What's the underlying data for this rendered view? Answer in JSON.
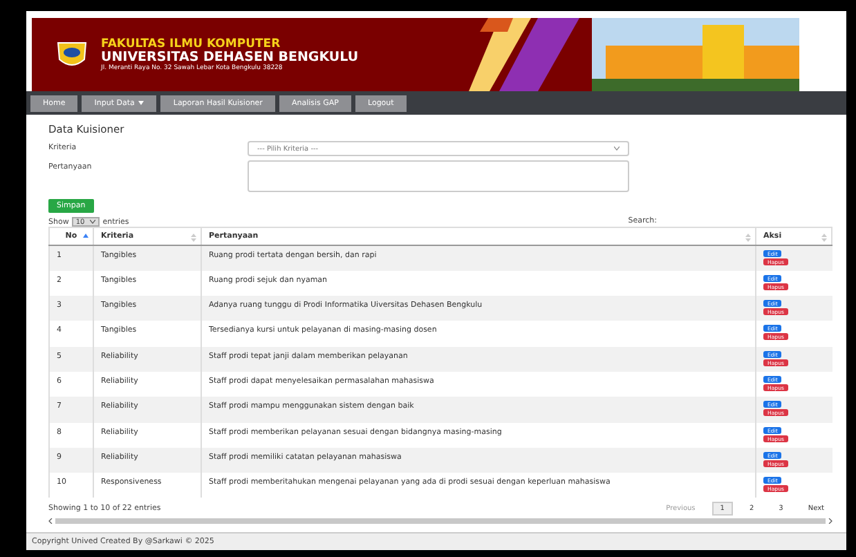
{
  "header": {
    "faculty": "FAKULTAS ILMU KOMPUTER",
    "university": "UNIVERSITAS DEHASEN BENGKULU",
    "address": "Jl. Meranti Raya No. 32 Sawah Lebar Kota Bengkulu 38228"
  },
  "nav": [
    {
      "label": "Home",
      "kind": "link"
    },
    {
      "label": "Input Data",
      "kind": "dropdown"
    },
    {
      "label": "Laporan Hasil Kuisioner",
      "kind": "link"
    },
    {
      "label": "Analisis GAP",
      "kind": "link"
    },
    {
      "label": "Logout",
      "kind": "link"
    }
  ],
  "form": {
    "title": "Data Kuisioner",
    "kriteria_label": "Kriteria",
    "kriteria_placeholder": "--- Pilih Kriteria ---",
    "pertanyaan_label": "Pertanyaan",
    "submit": "Simpan"
  },
  "table_controls": {
    "show": "Show",
    "page_size": "10",
    "entries": "entries",
    "search": "Search:"
  },
  "columns": [
    {
      "label": "No",
      "sorted": true
    },
    {
      "label": "Kriteria",
      "sorted": false
    },
    {
      "label": "Pertanyaan",
      "sorted": false
    },
    {
      "label": "Aksi",
      "sorted": false
    }
  ],
  "rows": [
    {
      "no": "1",
      "kriteria": "Tangibles",
      "pertanyaan": "Ruang prodi tertata dengan bersih, dan rapi",
      "edit": "Edit",
      "hapus": "Hapus"
    },
    {
      "no": "2",
      "kriteria": "Tangibles",
      "pertanyaan": "Ruang prodi sejuk dan nyaman",
      "edit": "Edit",
      "hapus": "Hapus"
    },
    {
      "no": "3",
      "kriteria": "Tangibles",
      "pertanyaan": "Adanya ruang tunggu di Prodi Informatika Uiversitas Dehasen Bengkulu",
      "edit": "Edit",
      "hapus": "Hapus"
    },
    {
      "no": "4",
      "kriteria": "Tangibles",
      "pertanyaan": "Tersedianya kursi untuk pelayanan di masing-masing dosen",
      "edit": "Edit",
      "hapus": "Hapus"
    },
    {
      "no": "5",
      "kriteria": "Reliability",
      "pertanyaan": "Staff prodi tepat janji dalam memberikan pelayanan",
      "edit": "Edit",
      "hapus": "Hapus"
    },
    {
      "no": "6",
      "kriteria": "Reliability",
      "pertanyaan": "Staff prodi dapat menyelesaikan permasalahan mahasiswa",
      "edit": "Edit",
      "hapus": "Hapus"
    },
    {
      "no": "7",
      "kriteria": "Reliability",
      "pertanyaan": "Staff prodi mampu menggunakan sistem dengan baik",
      "edit": "Edit",
      "hapus": "Hapus"
    },
    {
      "no": "8",
      "kriteria": "Reliability",
      "pertanyaan": "Staff prodi memberikan pelayanan sesuai dengan bidangnya masing-masing",
      "edit": "Edit",
      "hapus": "Hapus"
    },
    {
      "no": "9",
      "kriteria": "Reliability",
      "pertanyaan": "Staff prodi memiliki catatan pelayanan mahasiswa",
      "edit": "Edit",
      "hapus": "Hapus"
    },
    {
      "no": "10",
      "kriteria": "Responsiveness",
      "pertanyaan": "Staff prodi memberitahukan mengenai pelayanan yang ada di prodi sesuai dengan keperluan mahasiswa",
      "edit": "Edit",
      "hapus": "Hapus"
    }
  ],
  "table_info": "Showing 1 to 10 of 22 entries",
  "pagination": {
    "previous": "Previous",
    "pages": [
      {
        "label": "1",
        "selected": true
      },
      {
        "label": "2",
        "selected": false
      },
      {
        "label": "3",
        "selected": false
      }
    ],
    "next": "Next"
  },
  "footer": "Copyright Unived Created By @Sarkawi © 2025"
}
